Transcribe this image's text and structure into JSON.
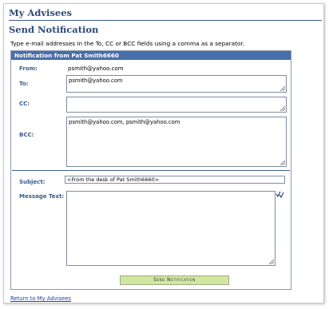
{
  "page": {
    "title": "My Advisees",
    "section_title": "Send Notification",
    "instructions": "Type e-mail addresses in the To, CC or BCC fields using a comma as a separator."
  },
  "panel": {
    "header": "Notification from Pat Smith6660"
  },
  "form": {
    "from_label": "From:",
    "from_value": "psmith@yahoo.com",
    "to_label": "To:",
    "to_value": "psmith@yahoo.com",
    "cc_label": "CC:",
    "cc_value": "",
    "bcc_label": "BCC:",
    "bcc_value": "psmith@yahoo.com, psmith@yahoo.com",
    "subject_label": "Subject:",
    "subject_value": "<From the desk of Pat Smith6660>",
    "message_label": "Message Text:",
    "message_value": ""
  },
  "actions": {
    "send_label": "Send Notification",
    "return_label": "Return to My Advisees"
  },
  "icons": {
    "spell_check": "spell-check-icon"
  },
  "colors": {
    "header_bg": "#4a6ea8",
    "label_blue": "#3a5b8f",
    "button_bg": "#d3e6a0",
    "link": "#1a3fa8"
  }
}
